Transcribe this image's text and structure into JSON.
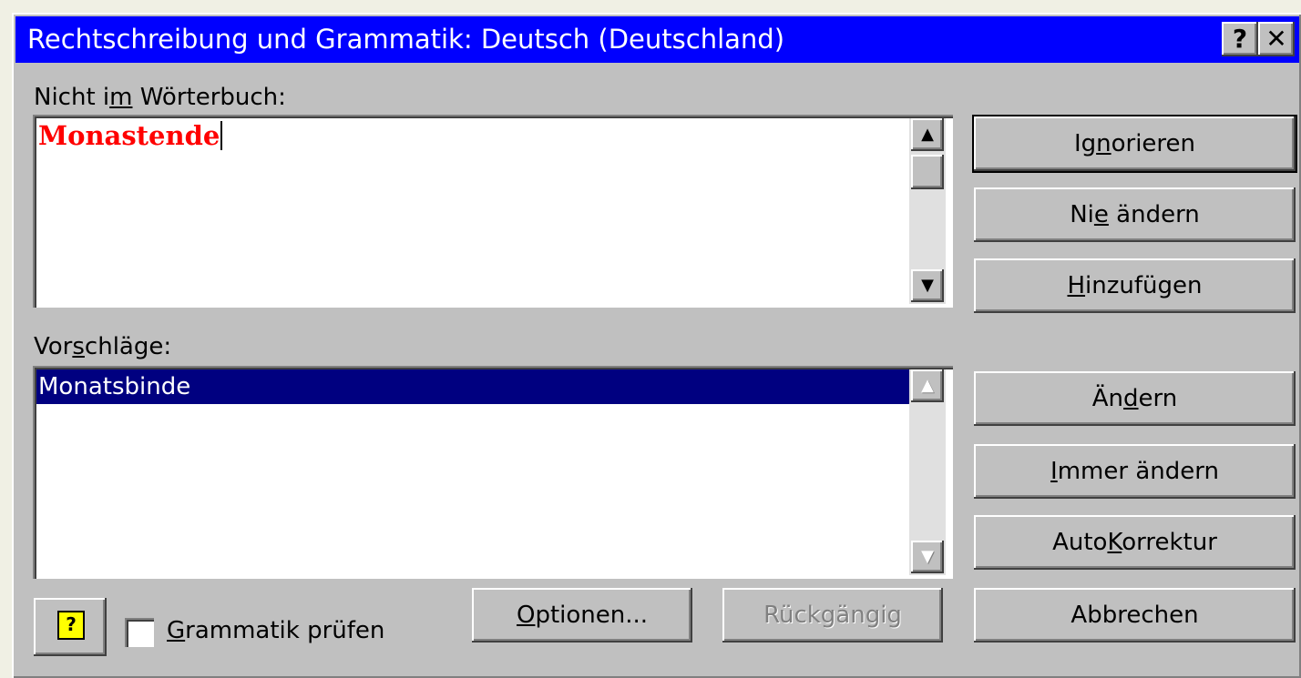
{
  "window": {
    "title": "Rechtschreibung und Grammatik: Deutsch (Deutschland)",
    "help_glyph": "?",
    "close_glyph": "✕"
  },
  "not_in_dictionary": {
    "label_pre": "Nicht i",
    "label_key": "m",
    "label_post": " Wörterbuch:",
    "word": "Monastende"
  },
  "suggestions": {
    "label_pre": "Vor",
    "label_key": "s",
    "label_post": "chläge:",
    "items": [
      "Monatsbinde"
    ]
  },
  "buttons": {
    "ignore": {
      "pre": "Ig",
      "key": "n",
      "post": "orieren"
    },
    "never_change": {
      "pre": "Ni",
      "key": "e",
      "post": " ändern"
    },
    "add": {
      "pre": "",
      "key": "H",
      "post": "inzufügen"
    },
    "change": {
      "pre": "Än",
      "key": "d",
      "post": "ern"
    },
    "always_change": {
      "pre": "",
      "key": "I",
      "post": "mmer ändern"
    },
    "autocorrect": {
      "pre": "Auto",
      "key": "K",
      "post": "orrektur"
    },
    "options": {
      "pre": "",
      "key": "O",
      "post": "ptionen..."
    },
    "undo": {
      "label": "Rückgängig"
    },
    "cancel": {
      "label": "Abbrechen"
    }
  },
  "grammar_checkbox": {
    "pre": "",
    "key": "G",
    "post": "rammatik prüfen",
    "checked": false
  },
  "icons": {
    "scroll_up": "▲",
    "scroll_down": "▼",
    "office_assistant": "?"
  }
}
